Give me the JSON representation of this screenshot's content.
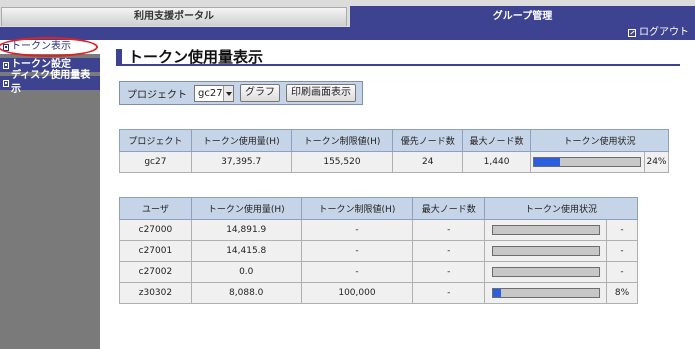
{
  "tabs": {
    "portal": "利用支援ポータル",
    "group": "グループ管理",
    "logout": "ログアウト"
  },
  "sidebar": {
    "items": [
      {
        "label": "トークン表示"
      },
      {
        "label": "トークン設定"
      },
      {
        "label": "ディスク使用量表示"
      }
    ]
  },
  "page": {
    "title": "トークン使用量表示"
  },
  "controls": {
    "project_label": "プロジェクト",
    "project_value": "gc27",
    "graph_button": "グラフ",
    "print_button": "印刷画面表示"
  },
  "project_table": {
    "headers": [
      "プロジェクト",
      "トークン使用量(H)",
      "トークン制限値(H)",
      "優先ノード数",
      "最大ノード数",
      "トークン使用状況"
    ],
    "row": {
      "project": "gc27",
      "used": "37,395.7",
      "limit": "155,520",
      "priority_nodes": "24",
      "max_nodes": "1,440",
      "usage_fraction": 0.24,
      "usage_text": "24%"
    }
  },
  "user_table": {
    "headers": [
      "ユーザ",
      "トークン使用量(H)",
      "トークン制限値(H)",
      "最大ノード数",
      "トークン使用状況"
    ],
    "rows": [
      {
        "user": "c27000",
        "used": "14,891.9",
        "limit": "-",
        "max_nodes": "-",
        "usage_fraction": 0,
        "usage_text": "-"
      },
      {
        "user": "c27001",
        "used": "14,415.8",
        "limit": "-",
        "max_nodes": "-",
        "usage_fraction": 0,
        "usage_text": "-"
      },
      {
        "user": "c27002",
        "used": "0.0",
        "limit": "-",
        "max_nodes": "-",
        "usage_fraction": 0,
        "usage_text": "-"
      },
      {
        "user": "z30302",
        "used": "8,088.0",
        "limit": "100,000",
        "max_nodes": "-",
        "usage_fraction": 0.08,
        "usage_text": "8%"
      }
    ]
  },
  "colors": {
    "brand": "#3d4390",
    "header_bg": "#c6d4e8",
    "bar_fill": "#2c5fe0",
    "highlight": "#e41f1f"
  }
}
